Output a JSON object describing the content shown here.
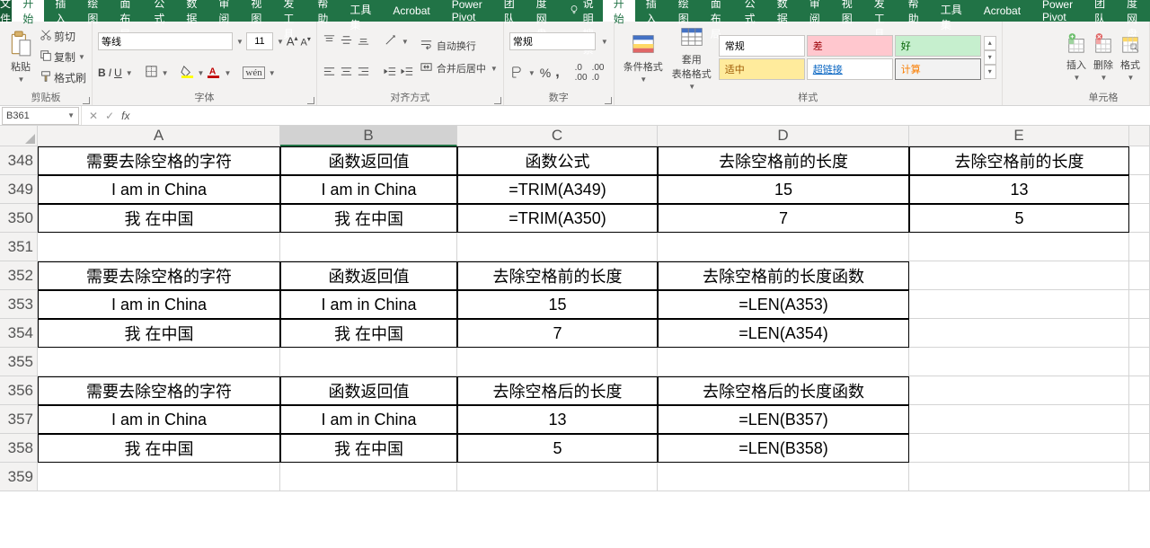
{
  "menu": {
    "file": "文件",
    "tabs": [
      "开始",
      "插入",
      "绘图",
      "页面布局",
      "公式",
      "数据",
      "审阅",
      "视图",
      "开发工具",
      "帮助",
      "PDF工具集",
      "Acrobat",
      "Power Pivot",
      "团队",
      "百度网盘"
    ],
    "active_tab_index": 0,
    "tell_me": "操作说明搜索"
  },
  "ribbon": {
    "clipboard": {
      "label": "剪贴板",
      "paste": "粘贴",
      "cut": "剪切",
      "copy": "复制",
      "format_painter": "格式刷"
    },
    "font": {
      "label": "字体",
      "name": "等线",
      "size": "11",
      "bold": "B",
      "italic": "I",
      "underline": "U"
    },
    "alignment": {
      "label": "对齐方式",
      "wrap": "自动换行",
      "merge": "合并后居中"
    },
    "number": {
      "label": "数字",
      "format": "常规"
    },
    "styles": {
      "label": "样式",
      "conditional": "条件格式",
      "as_table": "套用\n表格格式",
      "gallery": [
        {
          "text": "常规",
          "bg": "#ffffff",
          "fg": "#000",
          "border": "#c8c6c4"
        },
        {
          "text": "差",
          "bg": "#ffc7ce",
          "fg": "#9c0006",
          "border": "#c8c6c4"
        },
        {
          "text": "好",
          "bg": "#c6efce",
          "fg": "#006100",
          "border": "#c8c6c4"
        },
        {
          "text": "适中",
          "bg": "#ffeb9c",
          "fg": "#9c5700",
          "border": "#c8c6c4"
        },
        {
          "text": "超链接",
          "bg": "#ffffff",
          "fg": "#0563c1",
          "border": "#c8c6c4",
          "underline": true
        },
        {
          "text": "计算",
          "bg": "#f2f2f2",
          "fg": "#fa7d00",
          "border": "#7f7f7f"
        }
      ]
    },
    "cells": {
      "label": "单元格",
      "insert": "插入",
      "delete": "删除",
      "format": "格式"
    }
  },
  "formula_bar": {
    "name_box": "B361",
    "formula": ""
  },
  "grid": {
    "columns": [
      "A",
      "B",
      "C",
      "D",
      "E"
    ],
    "selected_column_index": 1,
    "first_row": 348,
    "row_count": 12,
    "selected_cell": {},
    "data": {
      "348": {
        "A": "需要去除空格的字符",
        "B": "函数返回值",
        "C": "函数公式",
        "D": "去除空格前的长度",
        "E": "去除空格前的长度"
      },
      "349": {
        "A": "I am in China",
        "B": "I am in China",
        "C": "=TRIM(A349)",
        "D": "15",
        "E": "13"
      },
      "350": {
        "A": "我 在中国",
        "B": "我 在中国",
        "C": "=TRIM(A350)",
        "D": "7",
        "E": "5"
      },
      "352": {
        "A": "需要去除空格的字符",
        "B": "函数返回值",
        "C": "去除空格前的长度",
        "D": "去除空格前的长度函数"
      },
      "353": {
        "A": "I am in China",
        "B": "I am in China",
        "C": "15",
        "D": "=LEN(A353)"
      },
      "354": {
        "A": "我 在中国",
        "B": "我 在中国",
        "C": "7",
        "D": "=LEN(A354)"
      },
      "356": {
        "A": "需要去除空格的字符",
        "B": "函数返回值",
        "C": "去除空格后的长度",
        "D": "去除空格后的长度函数"
      },
      "357": {
        "A": "I am in China",
        "B": "I am in China",
        "C": "13",
        "D": "=LEN(B357)"
      },
      "358": {
        "A": "我 在中国",
        "B": "我 在中国",
        "C": "5",
        "D": "=LEN(B358)"
      }
    },
    "bordered_ranges": [
      {
        "r1": 348,
        "r2": 350,
        "cols": [
          "A",
          "B",
          "C",
          "D",
          "E"
        ]
      },
      {
        "r1": 352,
        "r2": 354,
        "cols": [
          "A",
          "B",
          "C",
          "D"
        ]
      },
      {
        "r1": 356,
        "r2": 358,
        "cols": [
          "A",
          "B",
          "C",
          "D"
        ]
      }
    ]
  }
}
